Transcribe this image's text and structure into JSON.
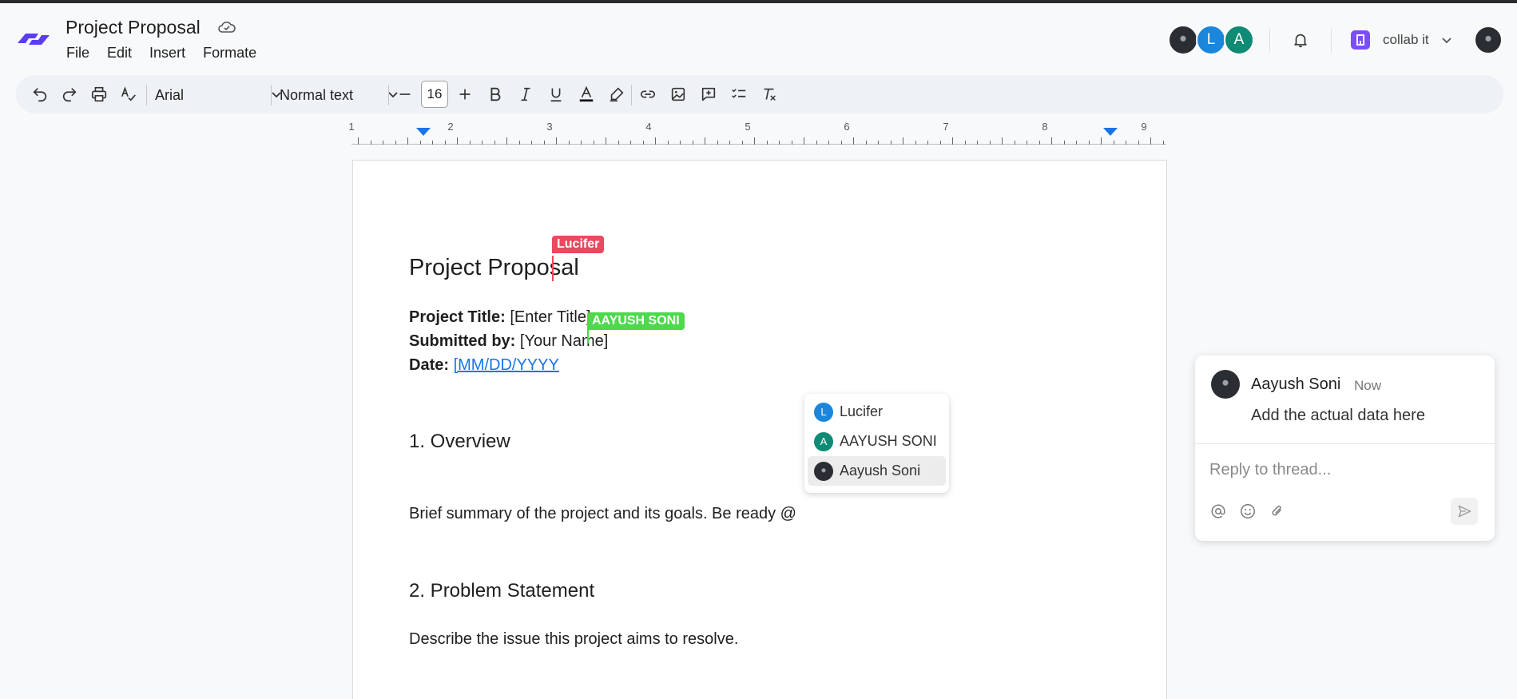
{
  "app": {
    "doc_title": "Project Proposal",
    "menu": [
      "File",
      "Edit",
      "Insert",
      "Formate"
    ],
    "collaborators": [
      {
        "initial": "",
        "color": "#2a2d31"
      },
      {
        "initial": "L",
        "color": "#1a86dc"
      },
      {
        "initial": "A",
        "color": "#0f8a74"
      }
    ],
    "workspace": "collab it"
  },
  "toolbar": {
    "font": "Arial",
    "style": "Normal text",
    "font_size": "16"
  },
  "ruler": {
    "numbers": [
      "1",
      "2",
      "3",
      "4",
      "5",
      "6",
      "7",
      "8",
      "9"
    ]
  },
  "doc": {
    "heading": "Project Proposal",
    "fields": [
      {
        "label": "Project Title:",
        "value": "[Enter Title]"
      },
      {
        "label": "Submitted by:",
        "value": "[Your Name]"
      },
      {
        "label": "Date:",
        "value": "[MM/DD/YYYY"
      }
    ],
    "overview_heading": "1. Overview",
    "overview_text": "Brief summary of the project and its goals. Be ready @",
    "problem_heading": "2. Problem Statement",
    "problem_text": "Describe the issue this project aims to resolve."
  },
  "cursors": [
    {
      "name": "Lucifer",
      "color": "#e84a5f"
    },
    {
      "name": "AAYUSH SONI",
      "color": "#4cd94c"
    }
  ],
  "mention_menu": {
    "items": [
      {
        "name": "Lucifer",
        "initial": "L",
        "color": "#1a86dc",
        "selected": false
      },
      {
        "name": "AAYUSH SONI",
        "initial": "A",
        "color": "#0f8a74",
        "selected": false
      },
      {
        "name": "Aayush Soni",
        "initial": "",
        "color": "#2a2d31",
        "selected": true
      }
    ]
  },
  "comment": {
    "author": "Aayush Soni",
    "time": "Now",
    "body": "Add the actual data here",
    "reply_placeholder": "Reply to thread..."
  }
}
